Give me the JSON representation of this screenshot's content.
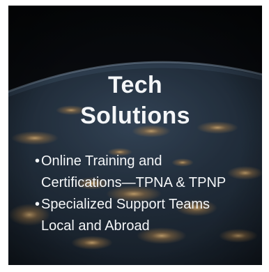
{
  "slide": {
    "title_line1": "Tech",
    "title_line2": "Solutions",
    "bullets": [
      {
        "line1": "Online Training and",
        "line2": "Certifications—TPNA & TPNP"
      },
      {
        "line1": "Specialized Support Teams",
        "line2": "Local and Abroad"
      }
    ],
    "bullet_glyph": "•",
    "background": {
      "kind": "night-earth-from-space-photo",
      "colors": {
        "space": "#0a0d12",
        "atmosphere": "#6f8aa6",
        "ocean": "#1d2b3a",
        "city_lights": "#e7b66a"
      }
    }
  }
}
